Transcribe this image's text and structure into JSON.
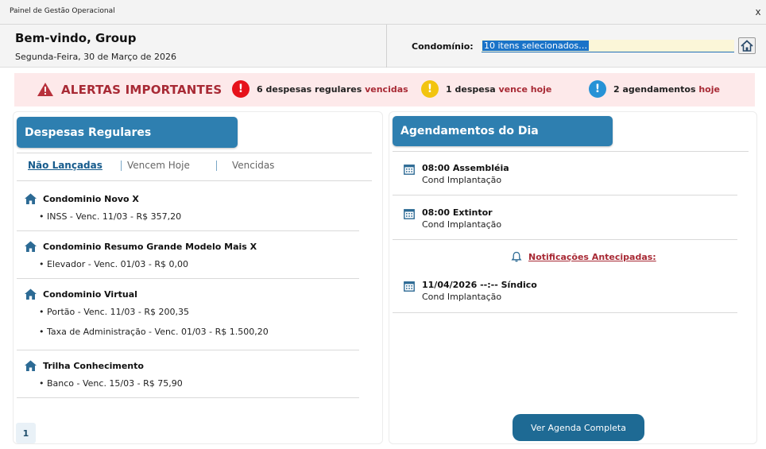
{
  "window": {
    "title": "Painel de Gestão Operacional",
    "close": "x"
  },
  "header": {
    "welcome": "Bem-vindo, Group",
    "date": "Segunda-Feira, 30 de Março de 2026",
    "condo_label": "Condomínio:",
    "condo_value": "10 itens selecionados…"
  },
  "alerts": {
    "title": "ALERTAS IMPORTANTES",
    "items": [
      {
        "text": "6 despesas regulares ",
        "highlight": "vencidas",
        "color": "#e6121a"
      },
      {
        "text": "1 despesa ",
        "highlight": "vence hoje",
        "color": "#f2c40f"
      },
      {
        "text": "2 agendamentos ",
        "highlight": "hoje",
        "color": "#2692d6"
      }
    ]
  },
  "expenses": {
    "title": "Despesas Regulares",
    "tabs": [
      "Não Lançadas",
      "Vencem Hoje",
      "Vencidas"
    ],
    "condos": [
      {
        "name": "Condominio Novo X",
        "lines": [
          "• INSS - Venc. 11/03 - R$ 357,20"
        ]
      },
      {
        "name": "Condominio Resumo Grande Modelo Mais X",
        "lines": [
          "• Elevador - Venc. 01/03 - R$ 0,00"
        ]
      },
      {
        "name": "Condominio Virtual",
        "lines": [
          "• Portão - Venc. 11/03 - R$ 200,35",
          "• Taxa de Administração - Venc. 01/03 - R$ 1.500,20"
        ]
      },
      {
        "name": "Trilha Conhecimento",
        "lines": [
          "• Banco - Venc. 15/03 - R$ 75,90"
        ]
      }
    ],
    "page": "1"
  },
  "schedule": {
    "title": "Agendamentos do Dia",
    "items": [
      {
        "title": "08:00 Assembléia",
        "sub": "Cond Implantação"
      },
      {
        "title": "08:00 Extintor",
        "sub": "Cond Implantação"
      }
    ],
    "notif_label": "Notificações Antecipadas:",
    "advance": [
      {
        "title": "11/04/2026 --:-- Síndico",
        "sub": "Cond Implantação"
      }
    ],
    "button": "Ver Agenda Completa"
  },
  "colors": {
    "accent": "#2e7fb0",
    "alert_bg": "#fde9ea",
    "alert_text": "#a82a35",
    "button": "#1e6a94"
  },
  "icons": {
    "warning": "warning-triangle-icon",
    "home": "home-icon",
    "calendar": "calendar-icon",
    "bell": "bell-icon"
  }
}
